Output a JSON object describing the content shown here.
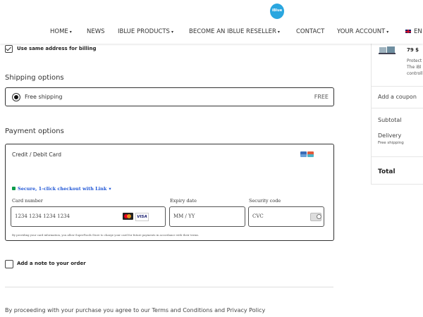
{
  "header": {
    "logo_text": "iBlue",
    "nav": [
      {
        "label": "HOME",
        "dropdown": true
      },
      {
        "label": "NEWS",
        "dropdown": false
      },
      {
        "label": "IBLUE PRODUCTS",
        "dropdown": true
      },
      {
        "label": "BECOME AN IBLUE RESELLER",
        "dropdown": true
      },
      {
        "label": "CONTACT",
        "dropdown": false
      },
      {
        "label": "YOUR ACCOUNT",
        "dropdown": true
      }
    ],
    "language": "EN",
    "caret": "▾"
  },
  "billing": {
    "same_address_label": "Use same address for billing",
    "checked": true
  },
  "shipping": {
    "title": "Shipping options",
    "option_label": "Free shipping",
    "option_price": "FREE"
  },
  "payment": {
    "title": "Payment options",
    "method_label": "Credit / Debit Card",
    "link_text": "Secure, 1-click checkout with Link",
    "card_number_label": "Card number",
    "card_number_placeholder": "1234 1234 1234 1234",
    "expiry_label": "Expiry date",
    "expiry_placeholder": "MM / YY",
    "security_label": "Security code",
    "security_placeholder": "CVC",
    "visa_text": "VISA",
    "disclaimer": "By providing your card information, you allow SuperFoods Store to charge your card for future payments in accordance with their terms."
  },
  "note": {
    "label": "Add a note to your order"
  },
  "terms_text": "By proceeding with your purchase you agree to our Terms and Conditions and Privacy Policy",
  "summary": {
    "price": "79 $",
    "desc_lines": [
      "Protect",
      "The iBl",
      "controll"
    ],
    "coupon": "Add a coupon",
    "subtotal": "Subtotal",
    "delivery": "Delivery",
    "delivery_sub": "Free shipping",
    "total": "Total"
  },
  "colors": {
    "accent": "#2aa6df",
    "link_green": "#0a9b4a",
    "link_blue": "#1f56d6"
  }
}
